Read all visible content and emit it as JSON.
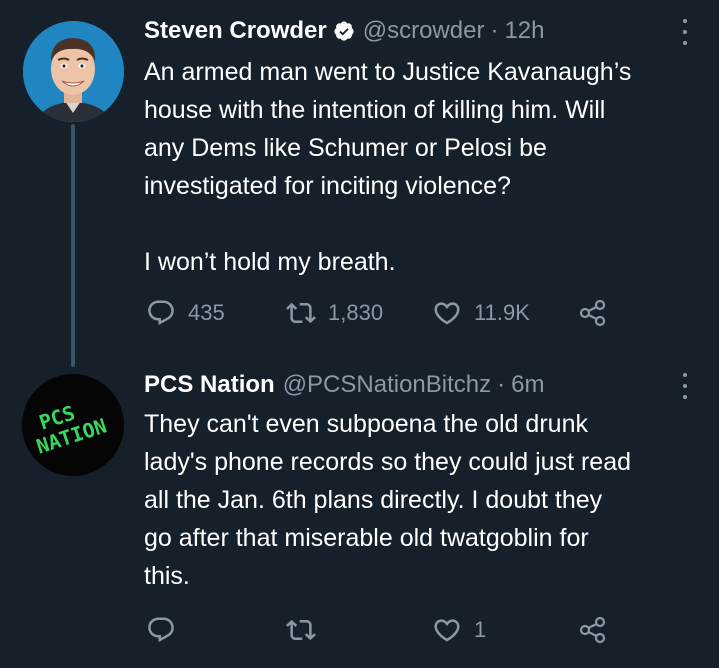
{
  "tweets": [
    {
      "name": "Steven Crowder",
      "verified": true,
      "handle": "@scrowder",
      "separator": "·",
      "time": "12h",
      "text_lines": [
        "An armed man went to Justice Kavanaugh’s",
        "house with the intention of killing him. Will",
        "any Dems like Schumer or Pelosi be",
        "investigated for inciting violence?"
      ],
      "text_last": "I won’t hold my breath.",
      "actions": {
        "reply": "435",
        "retweet": "1,830",
        "like": "11.9K"
      }
    },
    {
      "name": "PCS Nation",
      "handle": "@PCSNationBitchz",
      "separator": "·",
      "time": "6m",
      "avatar_text": [
        "PCS",
        "NATION"
      ],
      "text_lines": [
        "They can't even subpoena the old drunk",
        "lady's phone records so they could just read",
        "all the Jan. 6th plans directly. I doubt they",
        "go after that miserable old twatgoblin for",
        "this."
      ],
      "actions": {
        "reply": "",
        "retweet": "",
        "like": "1"
      }
    }
  ],
  "colors": {
    "background": "#15202b",
    "text": "#ffffff",
    "secondary": "#8b98a5",
    "verified": "#ffffff",
    "pcs_green": "#39d65a",
    "thread_line": "#3d5466"
  },
  "icons": [
    "reply-icon",
    "retweet-icon",
    "like-icon",
    "share-icon",
    "more-icon",
    "verified-badge-icon"
  ]
}
